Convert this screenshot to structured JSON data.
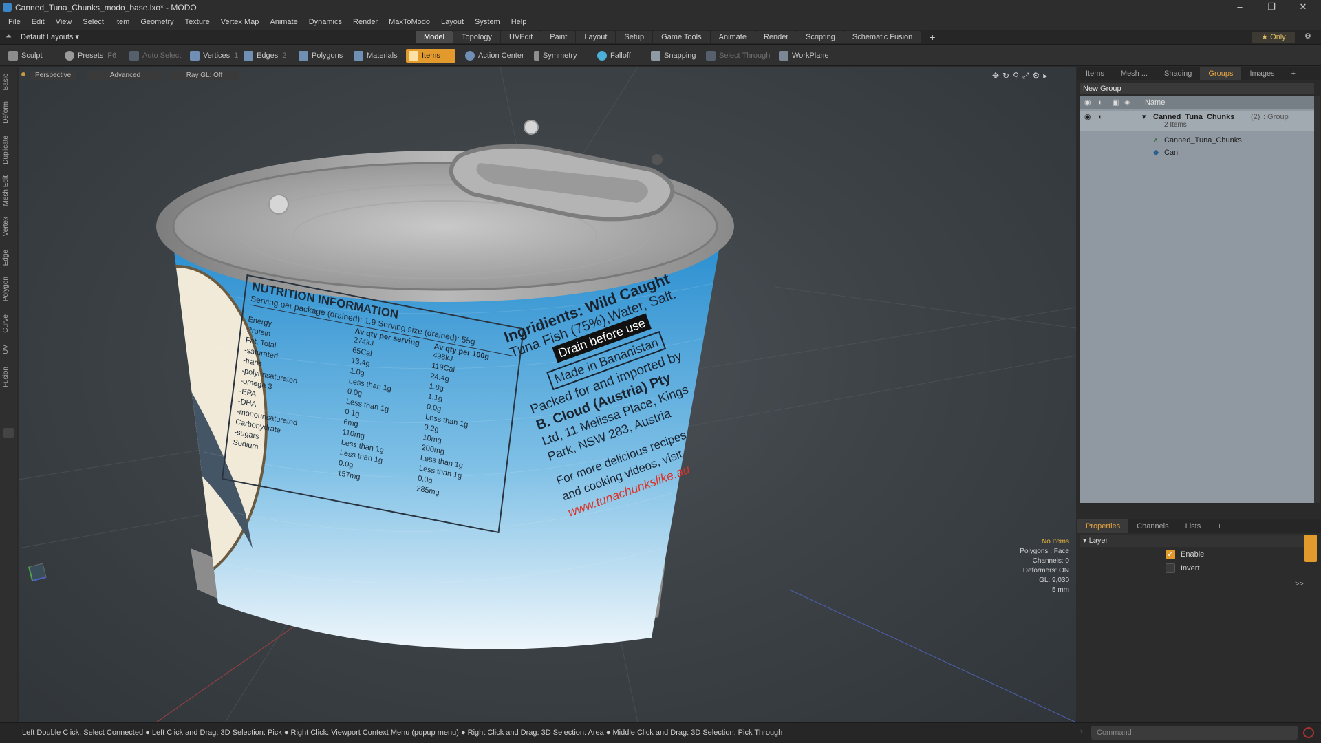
{
  "window": {
    "title": "Canned_Tuna_Chunks_modo_base.lxo* - MODO",
    "controls": [
      "–",
      "❐",
      "✕"
    ]
  },
  "menu": [
    "File",
    "Edit",
    "View",
    "Select",
    "Item",
    "Geometry",
    "Texture",
    "Vertex Map",
    "Animate",
    "Dynamics",
    "Render",
    "MaxToModo",
    "Layout",
    "System",
    "Help"
  ],
  "layouts": {
    "label": "Default Layouts ▾",
    "tabs": [
      "Model",
      "Topology",
      "UVEdit",
      "Paint",
      "Layout",
      "Setup",
      "Game Tools",
      "Animate",
      "Render",
      "Scripting",
      "Schematic Fusion"
    ],
    "active": "Model",
    "only": "★ Only"
  },
  "toolbar": {
    "sculpt": "Sculpt",
    "presets": "Presets",
    "presets_key": "F6",
    "auto_select": "Auto Select",
    "vertices": "Vertices",
    "vertices_key": "1",
    "edges": "Edges",
    "edges_key": "2",
    "polygons": "Polygons",
    "materials": "Materials",
    "items": "Items",
    "action_center": "Action Center",
    "symmetry": "Symmetry",
    "falloff": "Falloff",
    "snapping": "Snapping",
    "select_through": "Select Through",
    "workplane": "WorkPlane"
  },
  "left_tabs": [
    "Basic",
    "Deform",
    "Duplicate",
    "Mesh Edit",
    "Vertex",
    "Edge",
    "Polygon",
    "Curve",
    "UV",
    "Fusion"
  ],
  "viewport": {
    "view": "Perspective",
    "mode": "Advanced",
    "raygl": "Ray GL: Off",
    "info": {
      "items": "No Items",
      "polygons": "Polygons : Face",
      "channels": "Channels: 0",
      "deformers": "Deformers: ON",
      "gl": "GL: 9,030",
      "scale": "5 mm"
    }
  },
  "label": {
    "nutrition_title": "NUTRITION INFORMATION",
    "serving": "Serving per package (drained): 1.9 Serving size (drained): 55g",
    "col1": "Av qty per serving",
    "col2": "Av qty per 100g",
    "rows": [
      [
        "Energy",
        "274kJ",
        "498kJ"
      ],
      [
        "Protein",
        "65Cal",
        "119Cal"
      ],
      [
        "Fat, Total",
        "13.4g",
        "24.4g"
      ],
      [
        "-saturated",
        "1.0g",
        "1.8g"
      ],
      [
        "-trans",
        "Less than 1g",
        "1.1g"
      ],
      [
        "-polyunsaturated",
        "0.0g",
        "0.0g"
      ],
      [
        "-omega 3",
        "Less than 1g",
        "Less than 1g"
      ],
      [
        "-EPA",
        "0.1g",
        "0.2g"
      ],
      [
        "-DHA",
        "6mg",
        "10mg"
      ],
      [
        "-monounsaturated",
        "110mg",
        "200mg"
      ],
      [
        "Carbohydrate",
        "Less than 1g",
        "Less than 1g"
      ],
      [
        "-sugars",
        "Less than 1g",
        "Less than 1g"
      ],
      [
        "Sodium",
        "0.0g",
        "0.0g"
      ],
      [
        "",
        "157mg",
        "285mg"
      ]
    ],
    "ingredients": "Ingridients: Wild Caught",
    "tuna": "Tuna Fish (75%),Water, Salt.",
    "drain": "Drain before use",
    "made": "Made in Bananistan",
    "packed": "Packed for and imported by",
    "company": "B. Cloud (Austria) Pty",
    "address1": "Ltd, 11 Melissa Place, Kings",
    "address2": "Park, NSW 283, Austria",
    "recipes1": "For more delicious recipes",
    "recipes2": "and cooking videos, visit",
    "url": "www.tunachunkslike.au"
  },
  "panel": {
    "tabs": [
      "Items",
      "Mesh ...",
      "Shading",
      "Groups",
      "Images",
      "+"
    ],
    "active": "Groups",
    "new_group": "New Group",
    "name_header": "Name",
    "group": {
      "name": "Canned_Tuna_Chunks",
      "count": "(2)",
      "type": ": Group",
      "sub": "2 Items"
    },
    "children": [
      "Canned_Tuna_Chunks",
      "Can"
    ]
  },
  "properties": {
    "tabs": [
      "Properties",
      "Channels",
      "Lists",
      "+"
    ],
    "active": "Properties",
    "section": "Layer",
    "enable": "Enable",
    "invert": "Invert",
    "enable_on": true,
    "invert_on": false,
    "more": ">>"
  },
  "status": {
    "text": "Left Double Click: Select Connected ● Left Click and Drag: 3D Selection: Pick ● Right Click: Viewport Context Menu (popup menu) ● Right Click and Drag: 3D Selection: Area ● Middle Click and Drag: 3D Selection: Pick Through",
    "command_placeholder": "Command"
  },
  "colors": {
    "accent": "#e39a2c",
    "label_blue": "#2e8fcc",
    "url_red": "#d9352b"
  }
}
